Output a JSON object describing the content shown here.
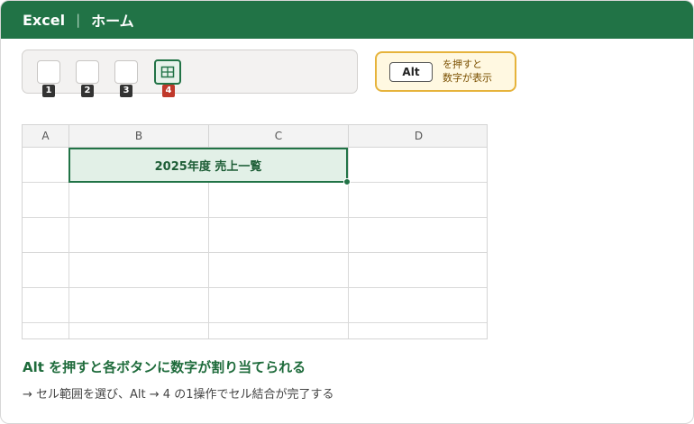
{
  "titlebar": {
    "app": "Excel",
    "separator": "|",
    "tab": "ホーム"
  },
  "ribbon": {
    "buttons": [
      {
        "badge": "1",
        "icon": "blank-button-icon"
      },
      {
        "badge": "2",
        "icon": "blank-button-icon"
      },
      {
        "badge": "3",
        "icon": "blank-button-icon"
      },
      {
        "badge": "4",
        "icon": "merge-cells-icon",
        "active": true
      }
    ]
  },
  "hint": {
    "key": "Alt",
    "line1": "を押すと",
    "line2": "数字が表示"
  },
  "sheet": {
    "columns": [
      "A",
      "B",
      "C",
      "D"
    ],
    "merged_cell": "2025年度 売上一覧"
  },
  "caption": {
    "title": "Alt を押すと各ボタンに数字が割り当てられる",
    "body": "→ セル範囲を選び、Alt → 4 の1操作でセル結合が完了する"
  },
  "colors": {
    "accent": "#217346",
    "badge_active": "#c0392b",
    "hint_border": "#e6b33b"
  }
}
